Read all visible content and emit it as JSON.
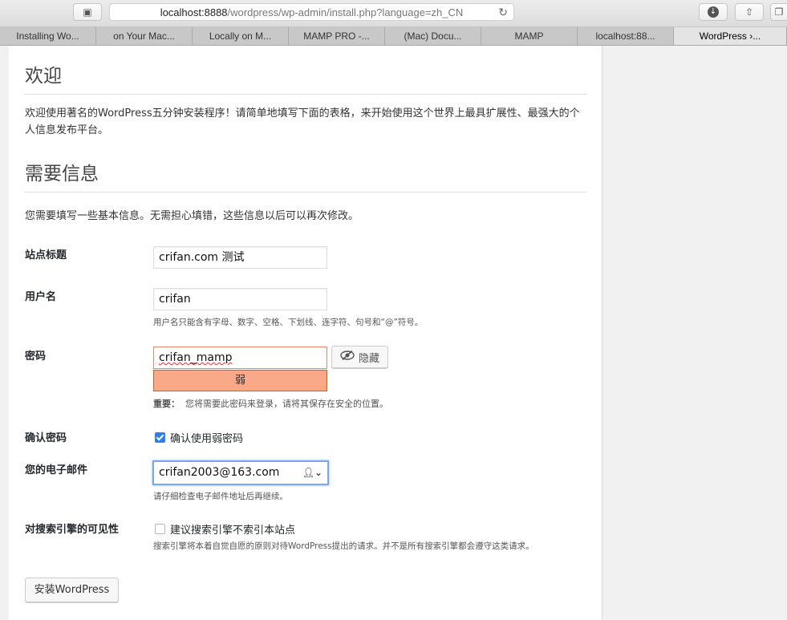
{
  "browser": {
    "url_host": "localhost:8888",
    "url_path": "/wordpress/wp-admin/install.php?language=zh_CN",
    "tabs": [
      {
        "label": "Installing Wo..."
      },
      {
        "label": "on Your Mac..."
      },
      {
        "label": "Locally on M..."
      },
      {
        "label": "MAMP PRO -..."
      },
      {
        "label": "(Mac) Docu..."
      },
      {
        "label": "MAMP"
      },
      {
        "label": "localhost:88..."
      },
      {
        "label": "WordPress ›..."
      }
    ]
  },
  "page": {
    "welcome_heading": "欢迎",
    "welcome_text": "欢迎使用著名的WordPress五分钟安装程序！请简单地填写下面的表格，来开始使用这个世界上最具扩展性、最强大的个人信息发布平台。",
    "info_heading": "需要信息",
    "info_text": "您需要填写一些基本信息。无需担心填错，这些信息以后可以再次修改。",
    "site_title": {
      "label": "站点标题",
      "value": "crifan.com 测试"
    },
    "username": {
      "label": "用户名",
      "value": "crifan",
      "hint": "用户名只能含有字母、数字、空格、下划线、连字符、句号和“@”符号。"
    },
    "password": {
      "label": "密码",
      "value": "crifan_mamp",
      "hide_label": "隐藏",
      "strength": "弱",
      "note_bold": "重要：",
      "note": "您将需要此密码来登录，请将其保存在安全的位置。"
    },
    "confirm_password": {
      "label": "确认密码",
      "checkbox_label": "确认使用弱密码",
      "checked": true
    },
    "email": {
      "label": "您的电子邮件",
      "value": "crifan2003@163.com",
      "hint": "请仔细检查电子邮件地址后再继续。"
    },
    "privacy": {
      "label": "对搜索引擎的可见性",
      "checkbox_label": "建议搜索引擎不索引本站点",
      "checked": false,
      "hint": "搜索引擎将本着自觉自愿的原则对待WordPress提出的请求。并不是所有搜索引擎都会遵守这类请求。"
    },
    "install_button": "安装WordPress"
  }
}
